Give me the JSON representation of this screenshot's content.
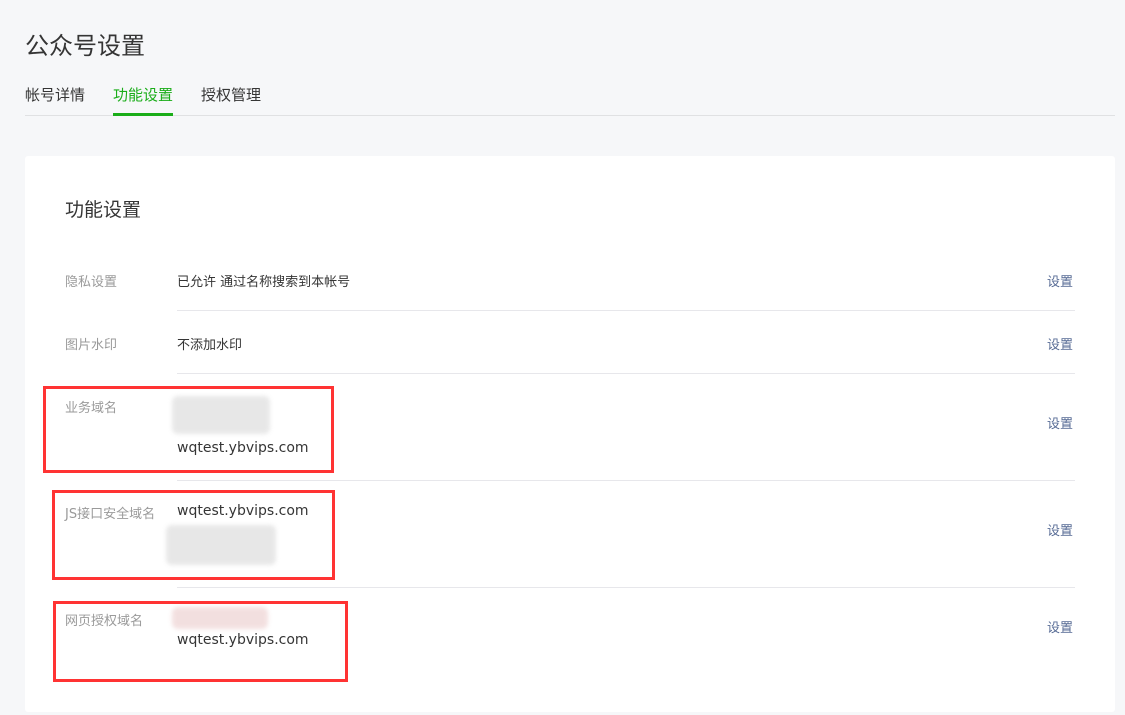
{
  "page_title": "公众号设置",
  "tabs": [
    {
      "label": "帐号详情"
    },
    {
      "label": "功能设置",
      "active": true
    },
    {
      "label": "授权管理"
    }
  ],
  "card": {
    "title": "功能设置",
    "rows": [
      {
        "label": "隐私设置",
        "value": "已允许 通过名称搜索到本帐号",
        "action": "设置"
      },
      {
        "label": "图片水印",
        "value": "不添加水印",
        "action": "设置"
      },
      {
        "label": "业务域名",
        "value": "wqtest.ybvips.com",
        "action": "设置"
      },
      {
        "label": "JS接口安全域名",
        "value": "wqtest.ybvips.com",
        "action": "设置"
      },
      {
        "label": "网页授权域名",
        "value": "wqtest.ybvips.com",
        "action": "设置"
      }
    ]
  },
  "colors": {
    "accent": "#1aad19",
    "link": "#576b95",
    "highlight": "#ff3333"
  }
}
